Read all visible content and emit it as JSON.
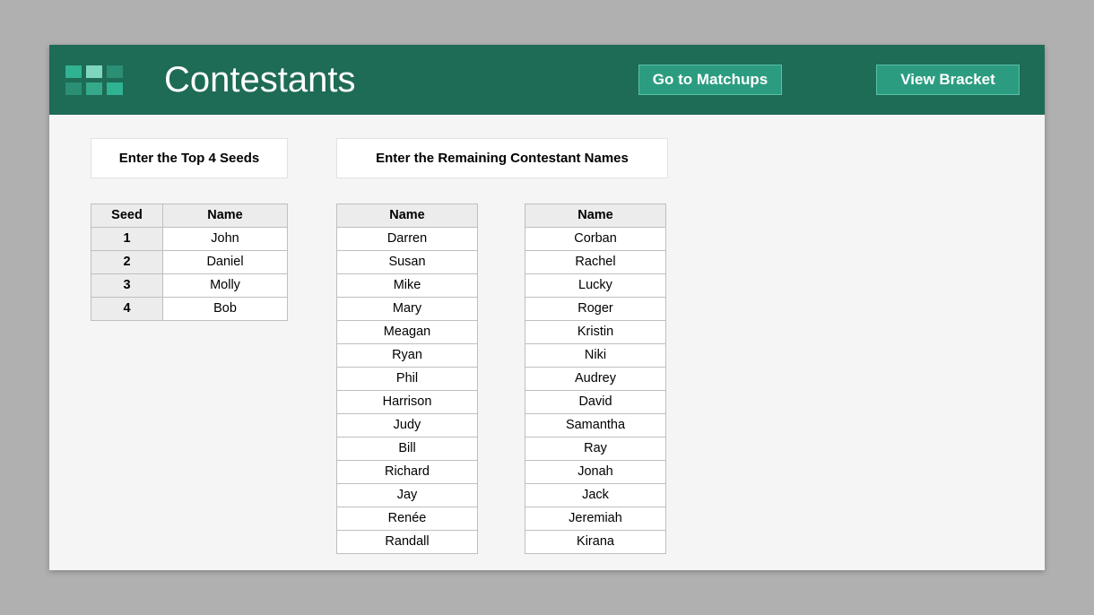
{
  "header": {
    "title": "Contestants",
    "btn_matchups": "Go to Matchups",
    "btn_bracket": "View Bracket"
  },
  "seeds": {
    "section_title": "Enter the Top 4 Seeds",
    "col_seed": "Seed",
    "col_name": "Name",
    "rows": [
      {
        "seed": "1",
        "name": "John"
      },
      {
        "seed": "2",
        "name": "Daniel"
      },
      {
        "seed": "3",
        "name": "Molly"
      },
      {
        "seed": "4",
        "name": "Bob"
      }
    ]
  },
  "remaining": {
    "section_title": "Enter the Remaining Contestant Names",
    "col_name": "Name",
    "col1": [
      "Darren",
      "Susan",
      "Mike",
      "Mary",
      "Meagan",
      "Ryan",
      "Phil",
      "Harrison",
      "Judy",
      "Bill",
      "Richard",
      "Jay",
      "Renée",
      "Randall"
    ],
    "col2": [
      "Corban",
      "Rachel",
      "Lucky",
      "Roger",
      "Kristin",
      "Niki",
      "Audrey",
      "David",
      "Samantha",
      "Ray",
      "Jonah",
      "Jack",
      "Jeremiah",
      "Kirana"
    ]
  }
}
